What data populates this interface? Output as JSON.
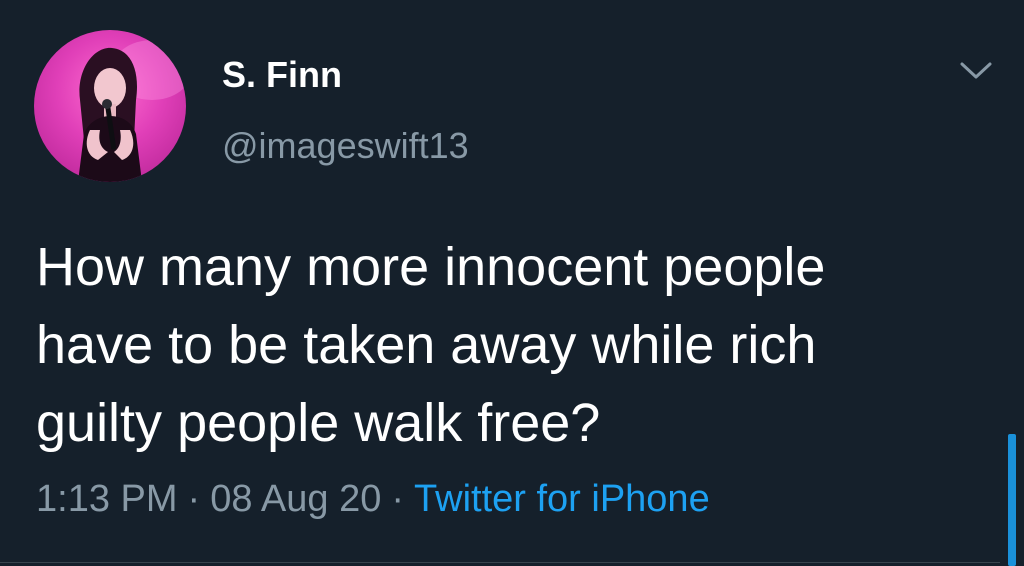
{
  "tweet": {
    "author": {
      "display_name": "S. Finn",
      "handle": "@imageswift13"
    },
    "text_lines": [
      "How many more innocent people",
      "have to be taken away while rich",
      "guilty people walk free?"
    ],
    "meta": {
      "time": "1:13 PM",
      "separator": "·",
      "date": "08 Aug 20",
      "source": "Twitter for iPhone"
    }
  },
  "icons": {
    "menu": "chevron-down-icon"
  },
  "colors": {
    "background": "#15202b",
    "primary_text": "#ffffff",
    "secondary_text": "#8899a6",
    "link": "#1da1f2"
  }
}
